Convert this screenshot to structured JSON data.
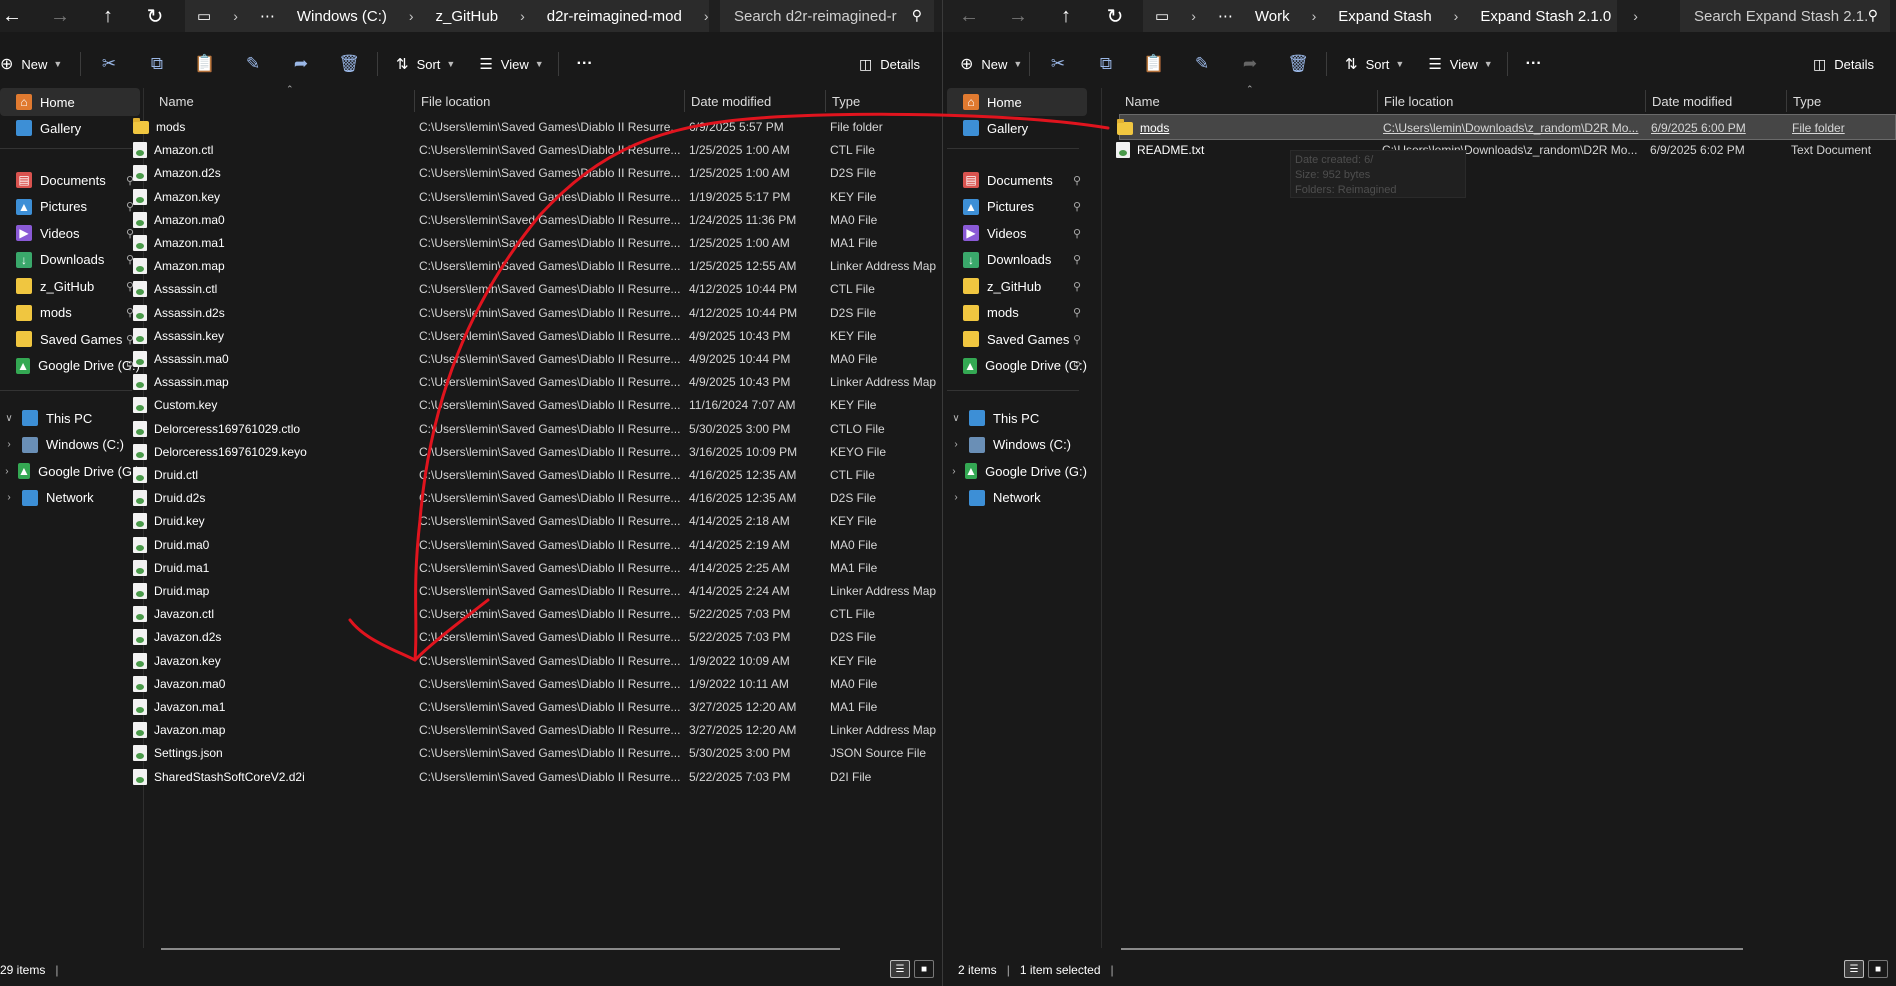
{
  "left": {
    "breadcrumb": [
      "Windows (C:)",
      "z_GitHub",
      "d2r-reimagined-mod"
    ],
    "search_placeholder": "Search d2r-reimagined-r",
    "toolbar": {
      "new": "New",
      "sort": "Sort",
      "view": "View",
      "more": "···",
      "details": "Details"
    },
    "columns": {
      "name": "Name",
      "location": "File location",
      "date": "Date modified",
      "type": "Type"
    },
    "sidebar": {
      "home": "Home",
      "gallery": "Gallery",
      "quick": [
        "Documents",
        "Pictures",
        "Videos",
        "Downloads",
        "z_GitHub",
        "mods",
        "Saved Games",
        "Google Drive (G:)"
      ],
      "this_pc": "This PC",
      "windows_c": "Windows (C:)",
      "google_drive": "Google Drive (G:)",
      "network": "Network"
    },
    "files": [
      {
        "name": "mods",
        "loc": "C:\\Users\\lemin\\Saved Games\\Diablo II Resurre...",
        "date": "6/9/2025 5:57 PM",
        "type": "File folder",
        "folder": true
      },
      {
        "name": "Amazon.ctl",
        "loc": "C:\\Users\\lemin\\Saved Games\\Diablo II Resurre...",
        "date": "1/25/2025 1:00 AM",
        "type": "CTL File"
      },
      {
        "name": "Amazon.d2s",
        "loc": "C:\\Users\\lemin\\Saved Games\\Diablo II Resurre...",
        "date": "1/25/2025 1:00 AM",
        "type": "D2S File"
      },
      {
        "name": "Amazon.key",
        "loc": "C:\\Users\\lemin\\Saved Games\\Diablo II Resurre...",
        "date": "1/19/2025 5:17 PM",
        "type": "KEY File"
      },
      {
        "name": "Amazon.ma0",
        "loc": "C:\\Users\\lemin\\Saved Games\\Diablo II Resurre...",
        "date": "1/24/2025 11:36 PM",
        "type": "MA0 File"
      },
      {
        "name": "Amazon.ma1",
        "loc": "C:\\Users\\lemin\\Saved Games\\Diablo II Resurre...",
        "date": "1/25/2025 1:00 AM",
        "type": "MA1 File"
      },
      {
        "name": "Amazon.map",
        "loc": "C:\\Users\\lemin\\Saved Games\\Diablo II Resurre...",
        "date": "1/25/2025 12:55 AM",
        "type": "Linker Address Map"
      },
      {
        "name": "Assassin.ctl",
        "loc": "C:\\Users\\lemin\\Saved Games\\Diablo II Resurre...",
        "date": "4/12/2025 10:44 PM",
        "type": "CTL File"
      },
      {
        "name": "Assassin.d2s",
        "loc": "C:\\Users\\lemin\\Saved Games\\Diablo II Resurre...",
        "date": "4/12/2025 10:44 PM",
        "type": "D2S File"
      },
      {
        "name": "Assassin.key",
        "loc": "C:\\Users\\lemin\\Saved Games\\Diablo II Resurre...",
        "date": "4/9/2025 10:43 PM",
        "type": "KEY File"
      },
      {
        "name": "Assassin.ma0",
        "loc": "C:\\Users\\lemin\\Saved Games\\Diablo II Resurre...",
        "date": "4/9/2025 10:44 PM",
        "type": "MA0 File"
      },
      {
        "name": "Assassin.map",
        "loc": "C:\\Users\\lemin\\Saved Games\\Diablo II Resurre...",
        "date": "4/9/2025 10:43 PM",
        "type": "Linker Address Map"
      },
      {
        "name": "Custom.key",
        "loc": "C:\\Users\\lemin\\Saved Games\\Diablo II Resurre...",
        "date": "11/16/2024 7:07 AM",
        "type": "KEY File"
      },
      {
        "name": "Delorceress169761029.ctlo",
        "loc": "C:\\Users\\lemin\\Saved Games\\Diablo II Resurre...",
        "date": "5/30/2025 3:00 PM",
        "type": "CTLO File"
      },
      {
        "name": "Delorceress169761029.keyo",
        "loc": "C:\\Users\\lemin\\Saved Games\\Diablo II Resurre...",
        "date": "3/16/2025 10:09 PM",
        "type": "KEYO File"
      },
      {
        "name": "Druid.ctl",
        "loc": "C:\\Users\\lemin\\Saved Games\\Diablo II Resurre...",
        "date": "4/16/2025 12:35 AM",
        "type": "CTL File"
      },
      {
        "name": "Druid.d2s",
        "loc": "C:\\Users\\lemin\\Saved Games\\Diablo II Resurre...",
        "date": "4/16/2025 12:35 AM",
        "type": "D2S File"
      },
      {
        "name": "Druid.key",
        "loc": "C:\\Users\\lemin\\Saved Games\\Diablo II Resurre...",
        "date": "4/14/2025 2:18 AM",
        "type": "KEY File"
      },
      {
        "name": "Druid.ma0",
        "loc": "C:\\Users\\lemin\\Saved Games\\Diablo II Resurre...",
        "date": "4/14/2025 2:19 AM",
        "type": "MA0 File"
      },
      {
        "name": "Druid.ma1",
        "loc": "C:\\Users\\lemin\\Saved Games\\Diablo II Resurre...",
        "date": "4/14/2025 2:25 AM",
        "type": "MA1 File"
      },
      {
        "name": "Druid.map",
        "loc": "C:\\Users\\lemin\\Saved Games\\Diablo II Resurre...",
        "date": "4/14/2025 2:24 AM",
        "type": "Linker Address Map"
      },
      {
        "name": "Javazon.ctl",
        "loc": "C:\\Users\\lemin\\Saved Games\\Diablo II Resurre...",
        "date": "5/22/2025 7:03 PM",
        "type": "CTL File"
      },
      {
        "name": "Javazon.d2s",
        "loc": "C:\\Users\\lemin\\Saved Games\\Diablo II Resurre...",
        "date": "5/22/2025 7:03 PM",
        "type": "D2S File"
      },
      {
        "name": "Javazon.key",
        "loc": "C:\\Users\\lemin\\Saved Games\\Diablo II Resurre...",
        "date": "1/9/2022 10:09 AM",
        "type": "KEY File"
      },
      {
        "name": "Javazon.ma0",
        "loc": "C:\\Users\\lemin\\Saved Games\\Diablo II Resurre...",
        "date": "1/9/2022 10:11 AM",
        "type": "MA0 File"
      },
      {
        "name": "Javazon.ma1",
        "loc": "C:\\Users\\lemin\\Saved Games\\Diablo II Resurre...",
        "date": "3/27/2025 12:20 AM",
        "type": "MA1 File"
      },
      {
        "name": "Javazon.map",
        "loc": "C:\\Users\\lemin\\Saved Games\\Diablo II Resurre...",
        "date": "3/27/2025 12:20 AM",
        "type": "Linker Address Map"
      },
      {
        "name": "Settings.json",
        "loc": "C:\\Users\\lemin\\Saved Games\\Diablo II Resurre...",
        "date": "5/30/2025 3:00 PM",
        "type": "JSON Source File"
      },
      {
        "name": "SharedStashSoftCoreV2.d2i",
        "loc": "C:\\Users\\lemin\\Saved Games\\Diablo II Resurre...",
        "date": "5/22/2025 7:03 PM",
        "type": "D2I File"
      }
    ],
    "status": "29 items"
  },
  "right": {
    "breadcrumb": [
      "Work",
      "Expand Stash",
      "Expand Stash 2.1.0"
    ],
    "search_placeholder": "Search Expand Stash 2.1.",
    "toolbar": {
      "new": "New",
      "sort": "Sort",
      "view": "View",
      "more": "···",
      "details": "Details"
    },
    "columns": {
      "name": "Name",
      "location": "File location",
      "date": "Date modified",
      "type": "Type"
    },
    "sidebar": {
      "home": "Home",
      "gallery": "Gallery",
      "quick": [
        "Documents",
        "Pictures",
        "Videos",
        "Downloads",
        "z_GitHub",
        "mods",
        "Saved Games",
        "Google Drive (G:)"
      ],
      "this_pc": "This PC",
      "windows_c": "Windows (C:)",
      "google_drive": "Google Drive (G:)",
      "network": "Network"
    },
    "files": [
      {
        "name": "mods",
        "loc": "C:\\Users\\lemin\\Downloads\\z_random\\D2R Mo...",
        "date": "6/9/2025 6:00 PM",
        "type": "File folder",
        "folder": true,
        "selected": true
      },
      {
        "name": "README.txt",
        "loc": "C:\\Users\\lemin\\Downloads\\z_random\\D2R Mo...",
        "date": "6/9/2025 6:02 PM",
        "type": "Text Document"
      }
    ],
    "tooltip": [
      "Date created: 6/",
      "Size: 952 bytes",
      "Folders: Reimagined"
    ],
    "status_items": "2 items",
    "status_selected": "1 item selected"
  },
  "colors": {
    "background": "#191919",
    "annotation": "#e0141e",
    "folder": "#f0c640",
    "selected_row": "#464646"
  }
}
